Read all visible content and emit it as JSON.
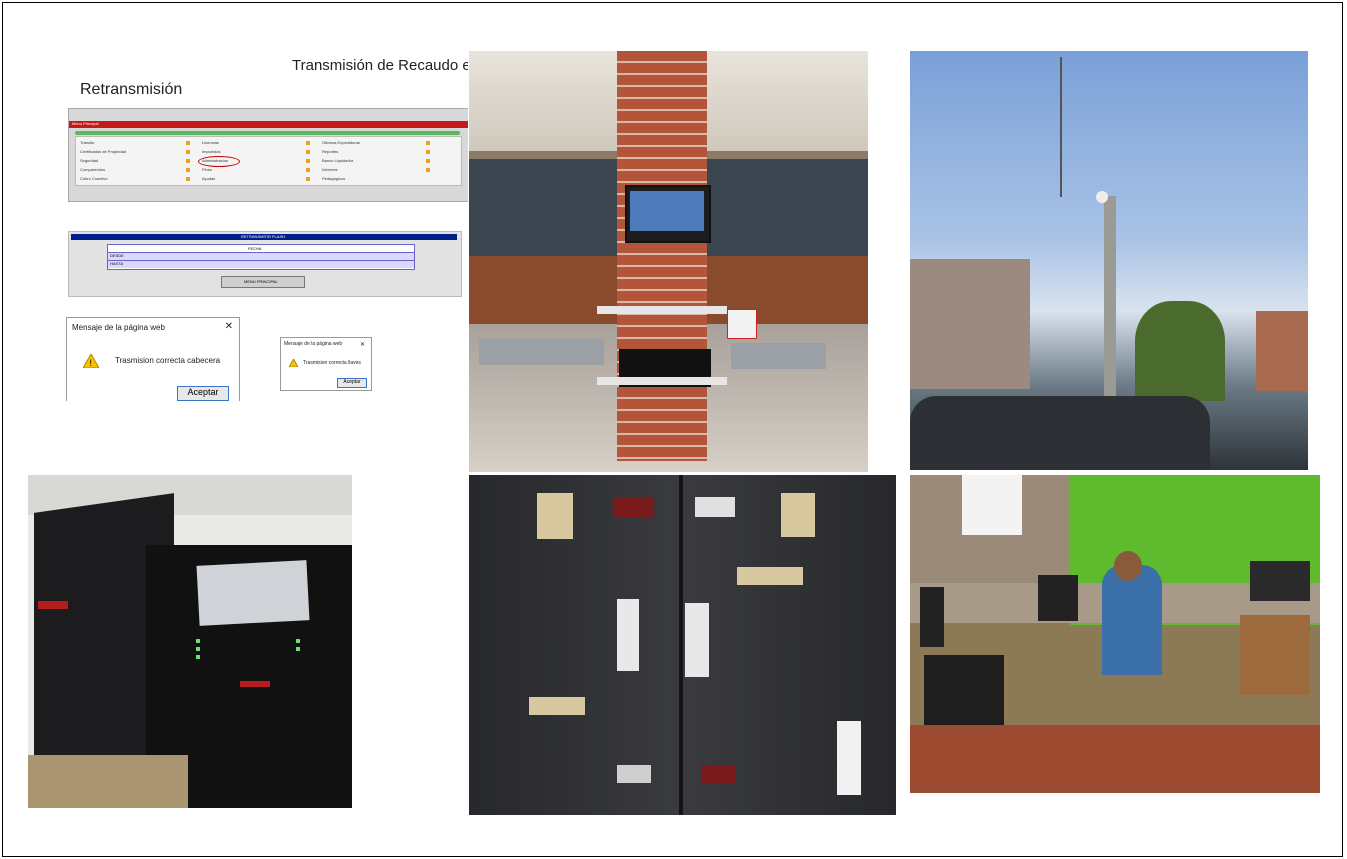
{
  "screenshot_panel": {
    "title": "Transmisión de Recaudo en",
    "subtitle": "Retransmisión",
    "menu": {
      "bar_title": "Menu Principal",
      "col1": [
        "Tránsito",
        "Certificados de Propiedad",
        "Seguridad",
        "Comparendos",
        "Cobro Coactivo"
      ],
      "col2": [
        "Licencias",
        "Impuestos",
        "Administracion",
        "Pines",
        "Ayudas"
      ],
      "col3": [
        "Oficinas Expedidoras",
        "Reportes",
        "Banco Liquidador",
        "Informes",
        "Pedagógicos"
      ]
    },
    "retransmit": {
      "bar_title": "RETRANSMITIR FLASH",
      "header": "FECHA",
      "row1_label": "DESDE",
      "row2_label": "HASTA",
      "button": "MENU PRINCIPAL"
    },
    "dialog_large": {
      "title": "Mensaje de la página web",
      "message": "Trasmision correcta cabecera",
      "button": "Aceptar"
    },
    "dialog_small": {
      "title": "Mensaje de la página web",
      "message": "Trasmision correcta llaves",
      "button": "Aceptar"
    }
  },
  "photos": {
    "lobby": "lobby-kiosk-photo",
    "sky": "street-camera-pole-photo",
    "ups": "apc-ups-units-photo",
    "battery": "ups-battery-packs-photo",
    "office": "office-workstation-photo"
  },
  "colors": {
    "menu_red": "#c31a1a",
    "menu_green": "#5cb85c",
    "retrans_blue": "#001f8c",
    "warning_yellow": "#f5c400"
  }
}
